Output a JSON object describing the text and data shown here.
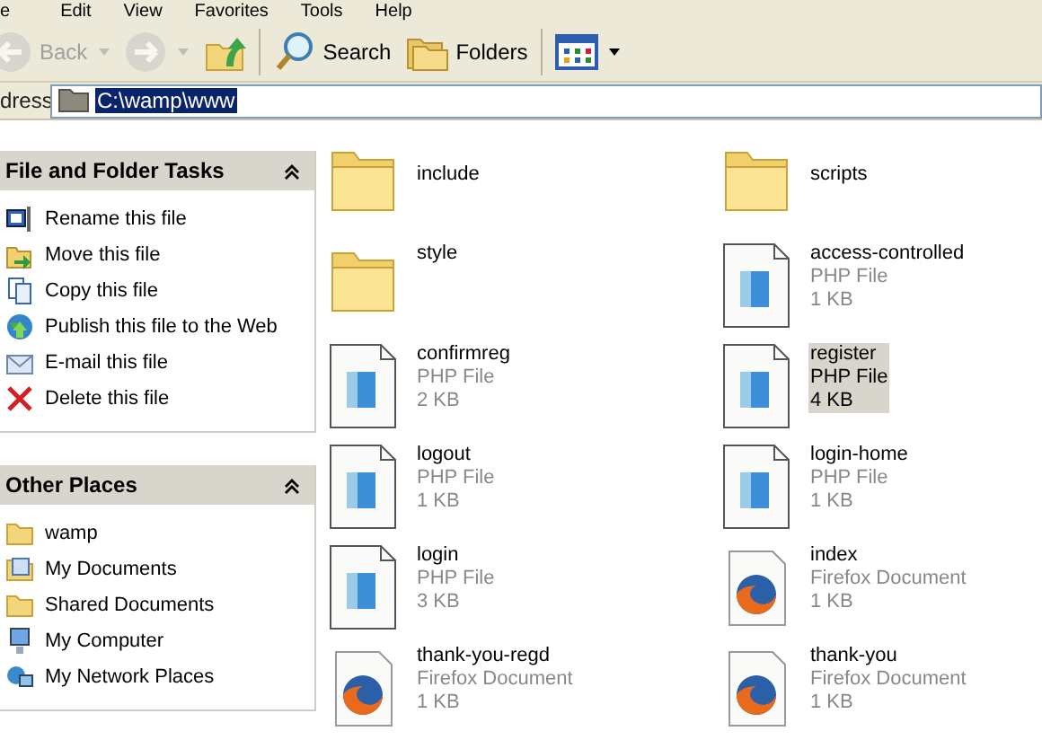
{
  "menu_bar": [
    "e",
    "Edit",
    "View",
    "Favorites",
    "Tools",
    "Help"
  ],
  "toolbar": [
    {
      "kind": "back",
      "label": "Back",
      "disabled": true
    },
    {
      "kind": "forward",
      "disabled": true
    },
    {
      "kind": "up",
      "disabled": false
    },
    {
      "kind": "search",
      "label": "Search",
      "disabled": false
    },
    {
      "kind": "folders",
      "label": "Folders",
      "disabled": false
    },
    {
      "kind": "views",
      "disabled": false
    }
  ],
  "address": {
    "label": "dress",
    "value": "C:\\wamp\\www",
    "selected": true
  },
  "sidebar": [
    {
      "title": "File and Folder Tasks",
      "expanded": true,
      "items": [
        {
          "kind": "rename",
          "label": "Rename this file"
        },
        {
          "kind": "move",
          "label": "Move this file"
        },
        {
          "kind": "copy",
          "label": "Copy this file"
        },
        {
          "kind": "publish",
          "label": "Publish this file to the Web"
        },
        {
          "kind": "email",
          "label": "E-mail this file"
        },
        {
          "kind": "delete",
          "label": "Delete this file"
        }
      ]
    },
    {
      "title": "Other Places",
      "expanded": true,
      "items": [
        {
          "kind": "folder",
          "label": "wamp"
        },
        {
          "kind": "documents",
          "label": "My Documents"
        },
        {
          "kind": "folder",
          "label": "Shared Documents"
        },
        {
          "kind": "computer",
          "label": "My Computer"
        },
        {
          "kind": "network",
          "label": "My Network Places"
        }
      ]
    }
  ],
  "files": [
    {
      "kind": "folder",
      "name": "include",
      "selected": false
    },
    {
      "kind": "folder",
      "name": "scripts",
      "selected": false
    },
    {
      "kind": "folder",
      "name": "style",
      "selected": false
    },
    {
      "kind": "php",
      "name": "access-controlled",
      "type": "PHP File",
      "size": "1 KB",
      "selected": false
    },
    {
      "kind": "php",
      "name": "confirmreg",
      "type": "PHP File",
      "size": "2 KB",
      "selected": false
    },
    {
      "kind": "php",
      "name": "register",
      "type": "PHP File",
      "size": "4 KB",
      "selected": true
    },
    {
      "kind": "php",
      "name": "logout",
      "type": "PHP File",
      "size": "1 KB",
      "selected": false
    },
    {
      "kind": "php",
      "name": "login-home",
      "type": "PHP File",
      "size": "1 KB",
      "selected": false
    },
    {
      "kind": "php",
      "name": "login",
      "type": "PHP File",
      "size": "3 KB",
      "selected": false
    },
    {
      "kind": "firefox",
      "name": "index",
      "type": "Firefox Document",
      "size": "1 KB",
      "selected": false
    },
    {
      "kind": "firefox",
      "name": "thank-you-regd",
      "type": "Firefox Document",
      "size": "1 KB",
      "selected": false
    },
    {
      "kind": "firefox",
      "name": "thank-you",
      "type": "Firefox Document",
      "size": "1 KB",
      "selected": false
    }
  ]
}
